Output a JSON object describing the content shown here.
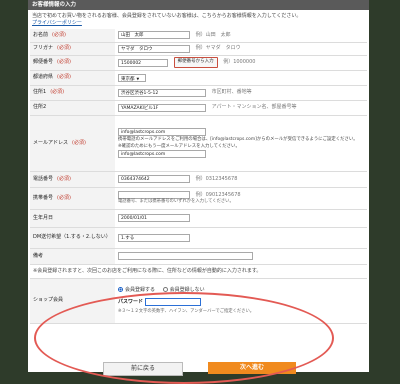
{
  "form": {
    "section_title": "お客様情報の入力",
    "intro_text": "当店で初めてお買い物をされるお客様、会員登録をされていないお客様は、こちらからお客様情報を入力してください。",
    "privacy_link": "プライバシーポリシー",
    "required_mark": "(必須)",
    "fields": {
      "name": {
        "label": "お名前",
        "value": "山田　太郎",
        "hint": "例）山田　太郎"
      },
      "furigana": {
        "label": "フリガナ",
        "value": "ヤマダ　タロウ",
        "hint": "例）ヤマダ　タロウ"
      },
      "postal": {
        "label": "郵便番号",
        "value": "1500002",
        "button": "郵便番号から入力",
        "hint": "例）1000000"
      },
      "prefecture": {
        "label": "都道府県",
        "value": "東京都"
      },
      "address1": {
        "label": "住所1",
        "value": "渋谷区渋谷1-5-12",
        "hint": "市区町村、番地等"
      },
      "address2": {
        "label": "住所2",
        "value": "YAMAZAKIビル1F",
        "hint": "アパート・マンション名、部屋番号等"
      },
      "email": {
        "label": "メールアドレス",
        "value": "info@lastcrops.com",
        "note1": "携帯電話のメールアドレスをご利用の場合は、[info@lastcrops.com]からのメールが受信できるようにご設定ください。",
        "note2": "※確認のためにもう一度メールアドレスを入力してください。",
        "confirm_value": "info@lastcrops.com"
      },
      "phone": {
        "label": "電話番号",
        "value": "0364374642",
        "hint": "例）0312345678"
      },
      "mobile": {
        "label": "携帯番号",
        "value": "",
        "hint": "例）09012345678",
        "note": "電話番号、または携帯番号のいずれかを入力してください。"
      },
      "birthday": {
        "label": "生年月日",
        "value": "2000/01/01"
      },
      "dm": {
        "label": "DM送付希望（1.する・2.しない）",
        "value": "1.する"
      },
      "remarks": {
        "label": "備考",
        "value": ""
      }
    },
    "membership_notice": "※会員登録されますと、次回このお店をご利用になる際に、住所などの情報が自動的に入力されます。",
    "membership": {
      "label": "ショップ会員",
      "option_register": "会員登録する",
      "option_no_register": "会員登録しない",
      "selected": "register",
      "password_label": "パスワード",
      "password_value": "",
      "password_note": "※３～１２文字の英数字、ハイフン、アンダーバーでご指定ください。"
    }
  },
  "buttons": {
    "back": "前に戻る",
    "next": "次へ進む"
  },
  "colors": {
    "header_bg": "#5a5a5a",
    "required": "#c0392b",
    "next_button": "#f08a1e",
    "highlight_ellipse": "#e35a54",
    "page_bg": "#2e3b2a"
  }
}
